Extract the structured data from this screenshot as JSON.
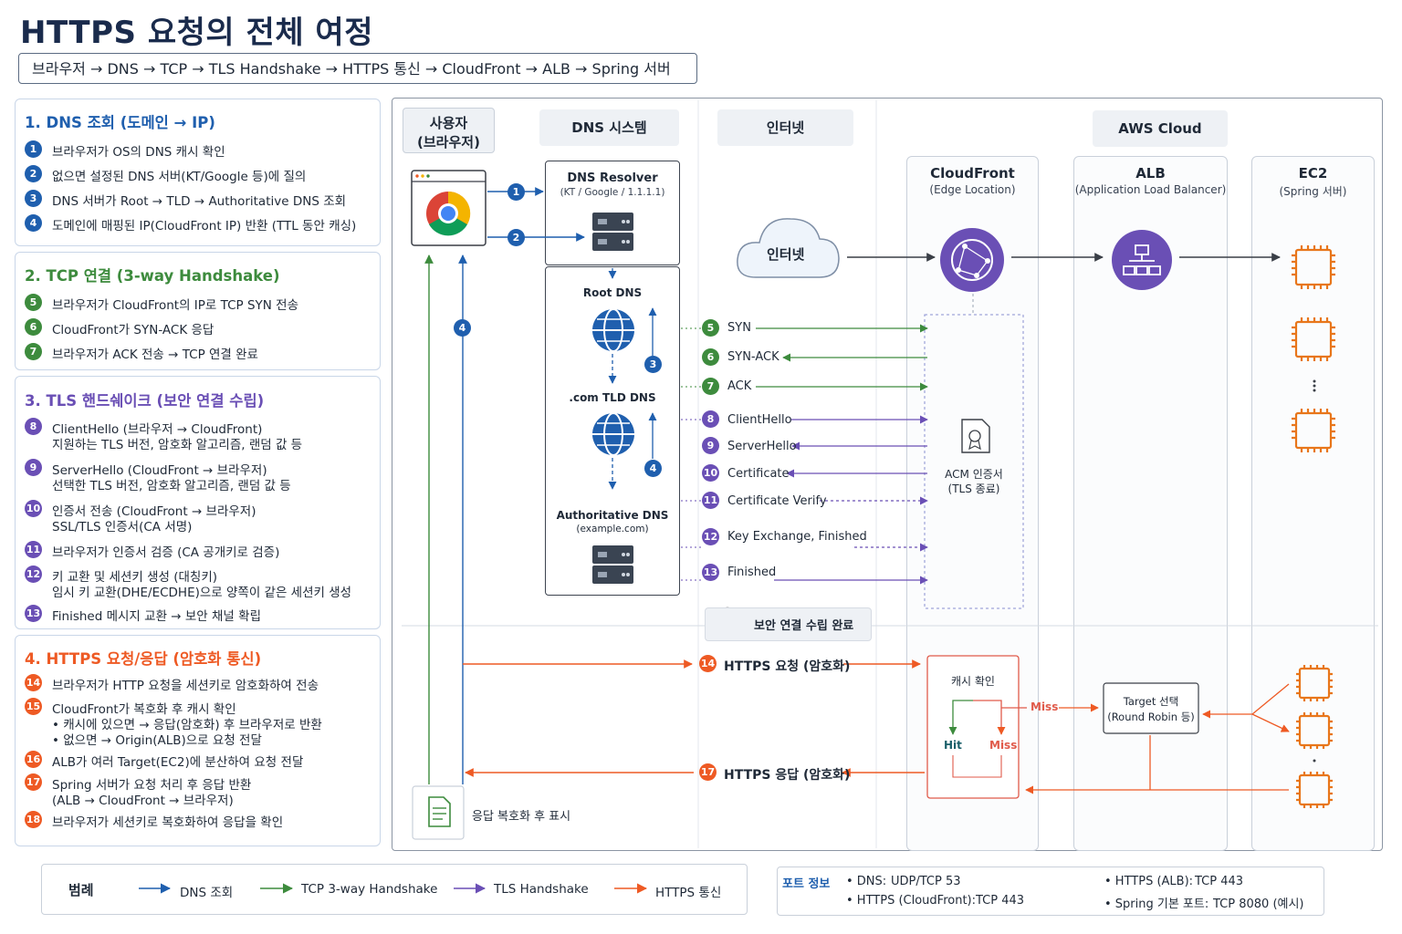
{
  "title": "HTTPS 요청의 전체 여정",
  "flow_summary": "브라우저 → DNS → TCP → TLS Handshake → HTTPS 통신 → CloudFront → ALB → Spring 서버",
  "colors": {
    "dns": "#1f5fae",
    "tcp": "#3d8b3d",
    "tls": "#6a4fb5",
    "https": "#ee5a24"
  },
  "sections": [
    {
      "title": "1. DNS 조회 (도메인 → IP)",
      "steps": [
        {
          "num": "1",
          "text": "브라우저가 OS의 DNS 캐시 확인"
        },
        {
          "num": "2",
          "text": "없으면 설정된 DNS 서버(KT/Google 등)에 질의"
        },
        {
          "num": "3",
          "text": "DNS 서버가 Root → TLD → Authoritative DNS 조회"
        },
        {
          "num": "4",
          "text": "도메인에 매핑된 IP(CloudFront IP) 반환 (TTL 동안 캐싱)"
        }
      ]
    },
    {
      "title": "2. TCP 연결 (3-way Handshake)",
      "steps": [
        {
          "num": "5",
          "text": "브라우저가 CloudFront의 IP로 TCP SYN 전송"
        },
        {
          "num": "6",
          "text": "CloudFront가 SYN-ACK 응답"
        },
        {
          "num": "7",
          "text": "브라우저가 ACK 전송 → TCP 연결 완료"
        }
      ]
    },
    {
      "title": "3. TLS 핸드쉐이크 (보안 연결 수립)",
      "steps": [
        {
          "num": "8",
          "text": "ClientHello (브라우저 → CloudFront)",
          "sub": "지원하는 TLS 버전, 암호화 알고리즘, 랜덤 값 등"
        },
        {
          "num": "9",
          "text": "ServerHello (CloudFront → 브라우저)",
          "sub": "선택한 TLS 버전, 암호화 알고리즘, 랜덤 값 등"
        },
        {
          "num": "10",
          "text": "인증서 전송 (CloudFront → 브라우저)",
          "sub": "SSL/TLS 인증서(CA 서명)"
        },
        {
          "num": "11",
          "text": "브라우저가 인증서 검증 (CA 공개키로 검증)"
        },
        {
          "num": "12",
          "text": "키 교환 및 세션키 생성 (대칭키)",
          "sub": "임시 키 교환(DHE/ECDHE)으로 양쪽이 같은 세션키 생성"
        },
        {
          "num": "13",
          "text": "Finished 메시지 교환 → 보안 채널 확립"
        }
      ]
    },
    {
      "title": "4. HTTPS 요청/응답 (암호화 통신)",
      "steps": [
        {
          "num": "14",
          "text": "브라우저가 HTTP 요청을 세션키로 암호화하여 전송"
        },
        {
          "num": "15",
          "text": "CloudFront가 복호화 후 캐시 확인",
          "sub": "• 캐시에 있으면 → 응답(암호화) 후 브라우저로 반환",
          "sub2": "• 없으면 → Origin(ALB)으로 요청 전달"
        },
        {
          "num": "16",
          "text": "ALB가 여러 Target(EC2)에 분산하여 요청 전달"
        },
        {
          "num": "17",
          "text": "Spring 서버가 요청 처리 후 응답 반환",
          "sub": "(ALB → CloudFront → 브라우저)"
        },
        {
          "num": "18",
          "text": "브라우저가 세션키로 복호화하여 응답을 확인"
        }
      ]
    }
  ],
  "diagram": {
    "user_header": "사용자\n(브라우저)",
    "user_header_l1": "사용자",
    "user_header_l2": "(브라우저)",
    "dns_header": "DNS 시스템",
    "internet_header": "인터넷",
    "aws_header": "AWS Cloud",
    "dns_resolver_title": "DNS Resolver",
    "dns_resolver_sub": "(KT / Google / 1.1.1.1)",
    "root_dns": "Root DNS",
    "tld_dns": ".com TLD DNS",
    "auth_dns_title": "Authoritative DNS",
    "auth_dns_sub": "(example.com)",
    "cloud_label": "인터넷",
    "cloudfront_title": "CloudFront",
    "cloudfront_sub": "(Edge Location)",
    "alb_title": "ALB",
    "alb_sub": "(Application Load Balancer)",
    "ec2_title": "EC2",
    "ec2_sub": "(Spring 서버)",
    "acm_l1": "ACM 인증서",
    "acm_l2": "(TLS 종료)",
    "tcp_msgs": [
      "SYN",
      "SYN-ACK",
      "ACK"
    ],
    "tls_msgs": [
      "ClientHello",
      "ServerHello",
      "Certificate",
      "Certificate Verify",
      "Key Exchange, Finished",
      "Finished"
    ],
    "secure_done": "보안 연결 수립 완료",
    "https_req": "HTTPS 요청 (암호화)",
    "https_res": "HTTPS 응답 (암호화)",
    "cache_check": "캐시 확인",
    "hit": "Hit",
    "miss": "Miss",
    "target_l1": "Target 선택",
    "target_l2": "(Round Robin 등)",
    "decrypt_display": "응답 복호화 후 표시",
    "dns_step_labels": [
      "1",
      "2",
      "3",
      "4",
      "4"
    ],
    "msg_nums": [
      "5",
      "6",
      "7",
      "8",
      "9",
      "10",
      "11",
      "12",
      "13"
    ],
    "https_nums": [
      "14",
      "17"
    ]
  },
  "legend": {
    "title": "범례",
    "items": [
      {
        "label": "DNS 조회",
        "color": "#1f5fae"
      },
      {
        "label": "TCP 3-way Handshake",
        "color": "#3d8b3d"
      },
      {
        "label": "TLS Handshake",
        "color": "#6a4fb5"
      },
      {
        "label": "HTTPS 통신",
        "color": "#ee5a24"
      }
    ]
  },
  "ports": {
    "title": "포트 정보",
    "items": [
      {
        "label": "• DNS:",
        "value": "UDP/TCP 53"
      },
      {
        "label": "• HTTPS (CloudFront):",
        "value": "TCP 443"
      },
      {
        "label": "• HTTPS (ALB):",
        "value": "TCP 443"
      },
      {
        "label": "• Spring 기본 포트:",
        "value": "TCP 8080 (예시)"
      }
    ]
  }
}
